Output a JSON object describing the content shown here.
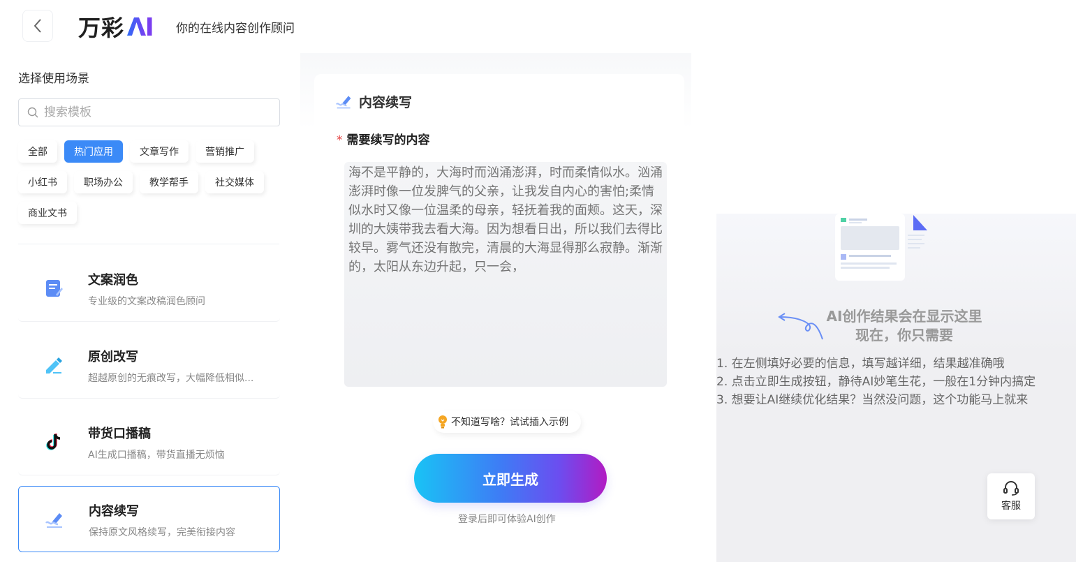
{
  "header": {
    "logo_text": "万彩",
    "logo_ai": "AI",
    "tagline": "你的在线内容创作顾问"
  },
  "sidebar": {
    "section_title": "选择使用场景",
    "search_placeholder": "搜索模板",
    "tags": [
      {
        "label": "全部",
        "active": false
      },
      {
        "label": "热门应用",
        "active": true
      },
      {
        "label": "文章写作",
        "active": false
      },
      {
        "label": "营销推广",
        "active": false
      },
      {
        "label": "小红书",
        "active": false
      },
      {
        "label": "职场办公",
        "active": false
      },
      {
        "label": "教学帮手",
        "active": false
      },
      {
        "label": "社交媒体",
        "active": false
      },
      {
        "label": "商业文书",
        "active": false
      }
    ],
    "templates": [
      {
        "title": "文案润色",
        "desc": "专业级的文案改稿润色顾问",
        "icon": "document-edit-icon"
      },
      {
        "title": "原创改写",
        "desc": "超越原创的无痕改写，大幅降低相似...",
        "icon": "pencil-icon"
      },
      {
        "title": "带货口播稿",
        "desc": "AI生成口播稿，带货直播无烦恼",
        "icon": "tiktok-icon"
      },
      {
        "title": "内容续写",
        "desc": "保持原文风格续写，完美衔接内容",
        "icon": "write-icon"
      }
    ]
  },
  "form": {
    "title": "内容续写",
    "field_required_mark": "*",
    "field_label": "需要续写的内容",
    "placeholder": "海不是平静的，大海时而汹涌澎湃，时而柔情似水。汹涌澎湃时像一位发脾气的父亲，让我发自内心的害怕;柔情似水时又像一位温柔的母亲，轻抚着我的面颊。这天，深圳的大姨带我去看大海。因为想看日出，所以我们去得比较早。雾气还没有散完，清晨的大海显得那么寂静。渐渐的，太阳从东边升起，只一会，",
    "hint": "不知道写啥？试试插入示例",
    "generate_button": "立即生成",
    "login_note": "登录后即可体验AI创作"
  },
  "result": {
    "heading_line1": "AI创作结果会在显示这里",
    "heading_line2": "现在，你只需要",
    "steps": [
      "1. 在左侧填好必要的信息，填写越详细，结果越准确哦",
      "2. 点击立即生成按钮，静待AI妙笔生花，一般在1分钟内搞定",
      "3. 想要让AI继续优化结果？当然没问题，这个功能马上就来"
    ]
  },
  "service": {
    "label": "客服"
  },
  "colors": {
    "accent": "#3b8af7",
    "required": "#e54545"
  }
}
